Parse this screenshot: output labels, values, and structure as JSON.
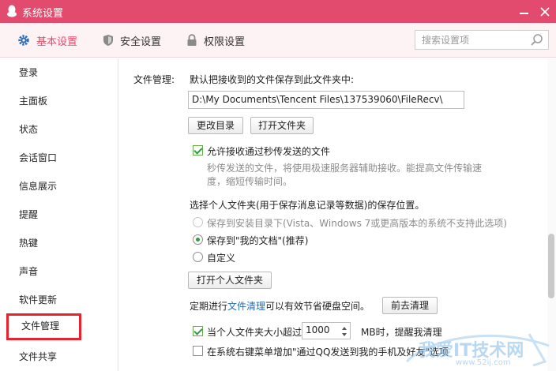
{
  "window": {
    "title": "系统设置"
  },
  "tabs": [
    {
      "label": "基本设置",
      "active": true
    },
    {
      "label": "安全设置",
      "active": false
    },
    {
      "label": "权限设置",
      "active": false
    }
  ],
  "search": {
    "placeholder": "搜索设置项"
  },
  "sidebar": {
    "items": [
      {
        "label": "登录"
      },
      {
        "label": "主面板"
      },
      {
        "label": "状态"
      },
      {
        "label": "会话窗口"
      },
      {
        "label": "信息展示"
      },
      {
        "label": "提醒"
      },
      {
        "label": "热键"
      },
      {
        "label": "声音"
      },
      {
        "label": "软件更新"
      },
      {
        "label": "文件管理",
        "selected": true
      },
      {
        "label": "文件共享"
      }
    ]
  },
  "file_management": {
    "section_label": "文件管理:",
    "save_to_label": "默认把接收到的文件保存到此文件夹中:",
    "save_path": "D:\\My Documents\\Tencent Files\\137539060\\FileRecv\\",
    "change_dir_button": "更改目录",
    "open_folder_button": "打开文件夹",
    "allow_secpass_label": "允许接收通过秒传发送的文件",
    "allow_secpass_checked": true,
    "secpass_desc_line1": "秒传发送的文件，将使用极速服务器辅助接收。能提高文件传输速",
    "secpass_desc_line2": "度，缩短传输时间。",
    "personal_folder_label": "选择个人文件夹(用于保存消息记录等数据)的保存位置。",
    "option_install_dir": "保存到安装目录下(Vista、Windows 7或更高版本的系统不支持此选项)",
    "option_my_documents": "保存到\"我的文档\"(推荐)",
    "option_custom": "自定义",
    "open_personal_folder_button": "打开个人文件夹",
    "cleanup_prefix": "定期进行",
    "cleanup_link": "文件清理",
    "cleanup_suffix": "可以有效节省硬盘空间。",
    "go_cleanup_button": "前去清理",
    "size_remind_prefix": "当个人文件夹大小超过",
    "size_remind_checked": true,
    "size_value": "1000",
    "size_remind_suffix": "MB时，提醒我清理",
    "context_menu_label": "在系统右键菜单增加\"通过QQ发送到我的手机及好友\"选项",
    "context_menu_checked": false
  },
  "watermark": {
    "text": "我爱IT技术网",
    "url": "www.52ij.com"
  },
  "colors": {
    "accent": "#e24b6d",
    "tab_bg": "#fdf3f5",
    "link": "#2a6bb5",
    "selection_outline": "#e8232c",
    "check": "#2f9e3a"
  }
}
